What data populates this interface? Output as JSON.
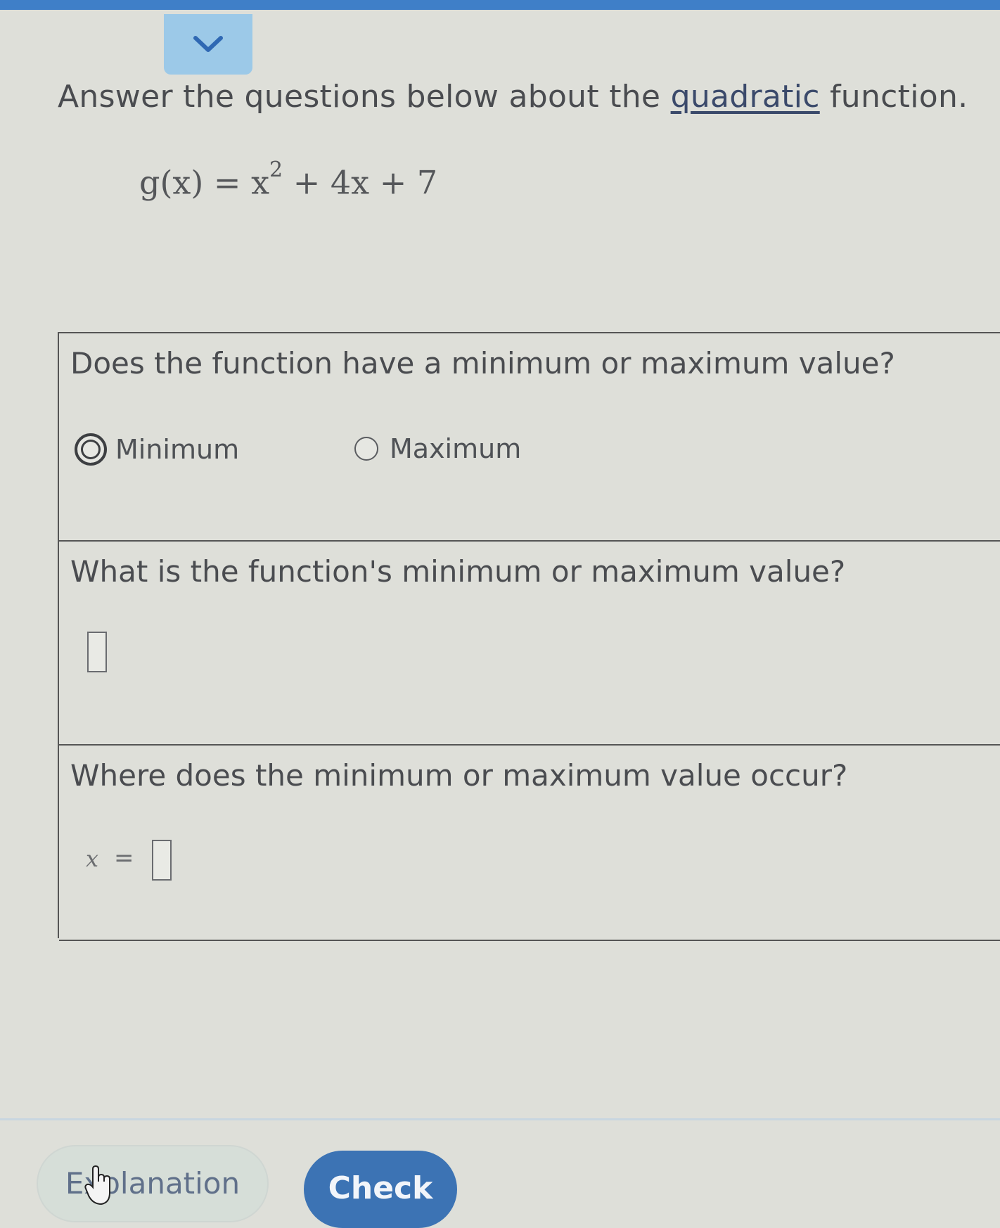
{
  "header": {
    "collapse_icon": "chevron-down-icon",
    "accent_color": "#9cc9e8"
  },
  "instruction": {
    "prefix": "Answer the questions below about the ",
    "term": "quadratic",
    "suffix": " function."
  },
  "equation": {
    "lhs": "g(x) = x",
    "exponent": "2",
    "rhs": " + 4x + 7"
  },
  "q1": {
    "text": "Does the function have a minimum or maximum value?",
    "options": [
      {
        "label": "Minimum",
        "selected": true
      },
      {
        "label": "Maximum",
        "selected": false
      }
    ]
  },
  "q2": {
    "text": "What is the function's minimum or maximum value?",
    "value": ""
  },
  "q3": {
    "text": "Where does the minimum or maximum value occur?",
    "var": "x",
    "eq": "=",
    "value": ""
  },
  "footer": {
    "explanation_label": "Explanation",
    "check_label": "Check",
    "check_color": "#3c73b4"
  }
}
